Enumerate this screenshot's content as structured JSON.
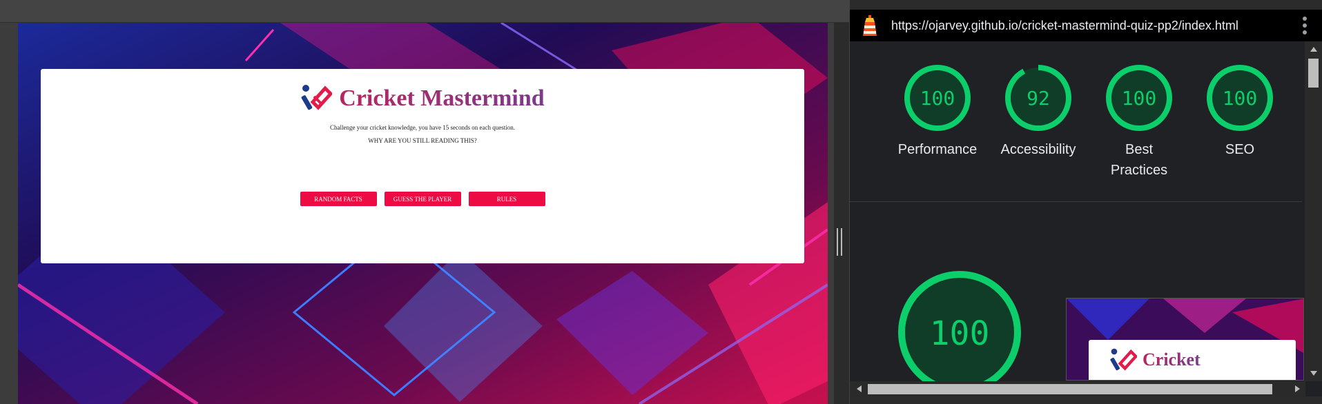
{
  "site": {
    "title": "Cricket Mastermind",
    "intro_line1": "Challenge your cricket knowledge, you have 15 seconds on each question.",
    "intro_line2": "WHY ARE YOU STILL READING THIS?",
    "buttons": [
      {
        "label": "RANDOM FACTS"
      },
      {
        "label": "GUESS THE PLAYER"
      },
      {
        "label": "RULES"
      }
    ]
  },
  "lighthouse": {
    "url": "https://ojarvey.github.io/cricket-mastermind-quiz-pp2/index.html",
    "scores": [
      {
        "value": "100",
        "label": "Performance",
        "fraction": 1.0
      },
      {
        "value": "92",
        "label": "Accessibility",
        "fraction": 0.92
      },
      {
        "value": "100",
        "label": "Best Practices",
        "fraction": 1.0
      },
      {
        "value": "100",
        "label": "SEO",
        "fraction": 1.0
      }
    ],
    "overall": {
      "value": "100",
      "fraction": 1.0
    },
    "thumbnail_title": "Cricket"
  },
  "colors": {
    "good": "#0cce6b",
    "button": "#ec0b43",
    "panel_bg": "#202124"
  },
  "icons": [
    "cricket-logo-icon",
    "lighthouse-icon",
    "kebab-menu-icon"
  ]
}
